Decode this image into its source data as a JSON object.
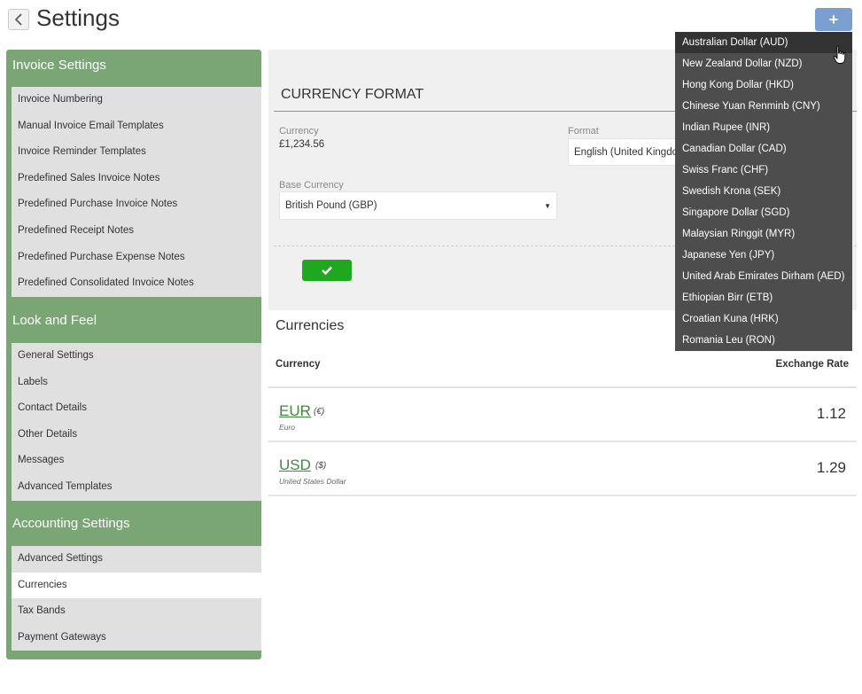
{
  "header": {
    "title": "Settings",
    "add_label": "+"
  },
  "sidebar": {
    "sections": [
      {
        "title": "Invoice Settings",
        "items": [
          "Invoice Numbering",
          "Manual Invoice Email Templates",
          "Invoice Reminder Templates",
          "Predefined Sales Invoice Notes",
          "Predefined Purchase Invoice Notes",
          "Predefined Receipt Notes",
          "Predefined Purchase Expense Notes",
          "Predefined Consolidated Invoice Notes"
        ]
      },
      {
        "title": "Look and Feel",
        "items": [
          "General Settings",
          "Labels",
          "Contact Details",
          "Other Details",
          "Messages",
          "Advanced Templates"
        ]
      },
      {
        "title": "Accounting Settings",
        "items": [
          "Advanced Settings",
          "Currencies",
          "Tax Bands",
          "Payment Gateways"
        ]
      }
    ],
    "active_item": "Currencies"
  },
  "currency_format": {
    "heading": "CURRENCY FORMAT",
    "currency_label": "Currency",
    "currency_value": "£1,234.56",
    "format_label": "Format",
    "format_value": "English (United Kingdom)",
    "base_currency_label": "Base Currency",
    "base_currency_value": "British Pound (GBP)",
    "save_icon": "check-icon"
  },
  "currencies": {
    "title": "Currencies",
    "col_currency": "Currency",
    "col_rate": "Exchange Rate",
    "rows": [
      {
        "code": "EUR",
        "symbol": "(€)",
        "name": "Euro",
        "rate": "1.12"
      },
      {
        "code": "USD",
        "symbol": "($)",
        "name": "United States Dollar",
        "rate": "1.29"
      }
    ]
  },
  "dropdown": {
    "hovered_index": 0,
    "options": [
      "Australian Dollar (AUD)",
      "New Zealand Dollar (NZD)",
      "Hong Kong Dollar (HKD)",
      "Chinese Yuan Renminb (CNY)",
      "Indian Rupee (INR)",
      "Canadian Dollar (CAD)",
      "Swiss Franc (CHF)",
      "Swedish Krona (SEK)",
      "Singapore Dollar (SGD)",
      "Malaysian Ringgit (MYR)",
      "Japanese Yen (JPY)",
      "United Arab Emirates Dirham (AED)",
      "Ethiopian Birr (ETB)",
      "Croatian Kuna (HRK)",
      "Romania Leu (RON)"
    ]
  },
  "colors": {
    "sidebar_green": "#7aa575",
    "save_green": "#1fa81f",
    "add_blue": "#7b9fd0",
    "dropdown_bg": "#4d4d4d"
  }
}
